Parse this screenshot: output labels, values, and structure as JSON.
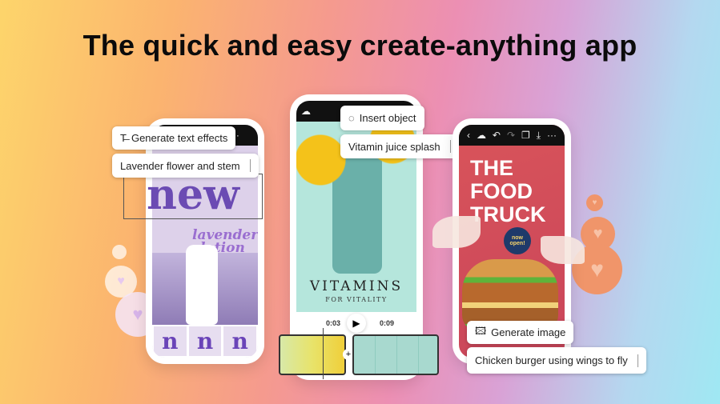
{
  "headline": "The quick and easy create-anything app",
  "left_phone": {
    "chip_action": "Generate text effects",
    "chip_prompt": "Lavender flower and stem",
    "effect_text": "new",
    "product_text_1": "lavender",
    "product_text_2": "lotion",
    "variations": [
      "n",
      "n",
      "n"
    ]
  },
  "middle_phone": {
    "chip_action": "Insert object",
    "chip_prompt": "Vitamin juice splash",
    "poster_title": "VITAMINS",
    "poster_subtitle": "FOR VITALITY",
    "time_current": "0:03",
    "time_total": "0:09",
    "add_clip": "+"
  },
  "right_phone": {
    "poster_line1": "THE",
    "poster_line2": "FOOD",
    "poster_line3": "TRUCK",
    "badge": "now open!",
    "chip_action": "Generate image",
    "chip_prompt": "Chicken burger using wings to fly"
  },
  "colors": {
    "accent_orange": "#f0956a",
    "lavender": "#d9cde8",
    "mint": "#b5e6dc",
    "poster_red": "#d9545a"
  }
}
